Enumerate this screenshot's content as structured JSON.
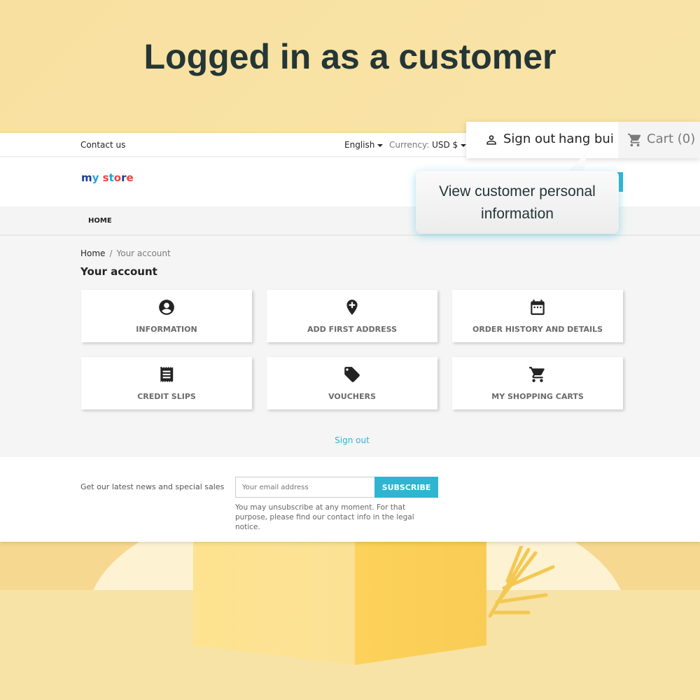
{
  "headline": "Logged in as a customer",
  "topbar": {
    "contact": "Contact us",
    "language": "English",
    "currency_label": "Currency:",
    "currency_value": "USD $"
  },
  "logo": {
    "letters": [
      "m",
      "y",
      " ",
      "s",
      "t",
      "o",
      "r",
      "e"
    ],
    "text": "my store"
  },
  "nav": {
    "home": "HOME"
  },
  "breadcrumb": {
    "home": "Home",
    "separator": "/",
    "current": "Your account"
  },
  "page_title": "Your account",
  "tiles": [
    {
      "label": "INFORMATION",
      "icon": "account-circle-icon"
    },
    {
      "label": "ADD FIRST ADDRESS",
      "icon": "add-location-icon"
    },
    {
      "label": "ORDER HISTORY AND DETAILS",
      "icon": "calendar-icon"
    },
    {
      "label": "CREDIT SLIPS",
      "icon": "receipt-icon"
    },
    {
      "label": "VOUCHERS",
      "icon": "tag-icon"
    },
    {
      "label": "MY SHOPPING CARTS",
      "icon": "shopping-cart-icon"
    }
  ],
  "signout_link": "Sign out",
  "footer": {
    "newsletter_text": "Get our latest news and special sales",
    "email_placeholder": "Your email address",
    "subscribe": "SUBSCRIBE",
    "note": "You may unsubscribe at any moment. For that purpose, please find our contact info in the legal notice."
  },
  "userbar": {
    "signout": "Sign out",
    "customer_name": "hang bui",
    "cart": "Cart (0)"
  },
  "tooltip": {
    "line1": "View customer personal",
    "line2": "information"
  },
  "colors": {
    "accent": "#2fb5d2",
    "background": "#f8e0a0",
    "headline": "#243636"
  }
}
